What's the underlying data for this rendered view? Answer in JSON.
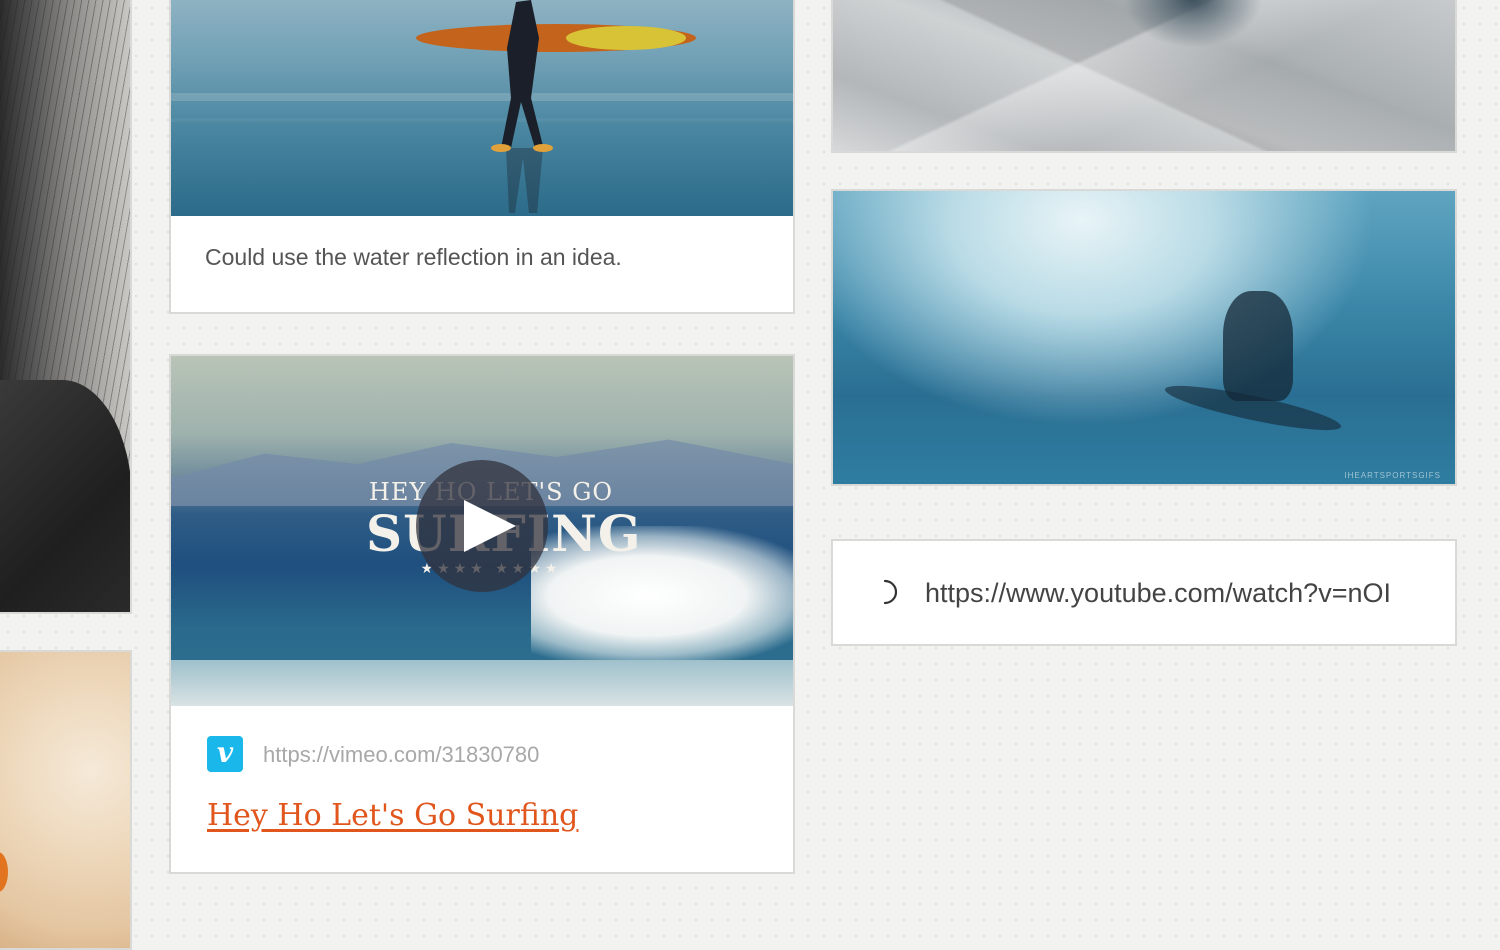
{
  "cards": {
    "surf_photo": {
      "caption": "Could use the water reflection in an idea."
    },
    "video": {
      "overlay_top": "HEY HO LET'S GO",
      "overlay_big": "SURFING",
      "overlay_stars": "★★★★   ★★★★",
      "provider_icon": "vimeo-icon",
      "provider_letter": "v",
      "url": "https://vimeo.com/31830780",
      "link_title": "Hey Ho Let's Go Surfing"
    },
    "wave_gif": {
      "watermark": "IHEARTSPORTSGIFS"
    },
    "url_input": {
      "value": "https://www.youtube.com/watch?v=nOI",
      "icon": "loading-spinner-icon"
    }
  },
  "colors": {
    "link": "#e1561d",
    "vimeo": "#1ab7ea",
    "background": "#f2f2f1"
  }
}
